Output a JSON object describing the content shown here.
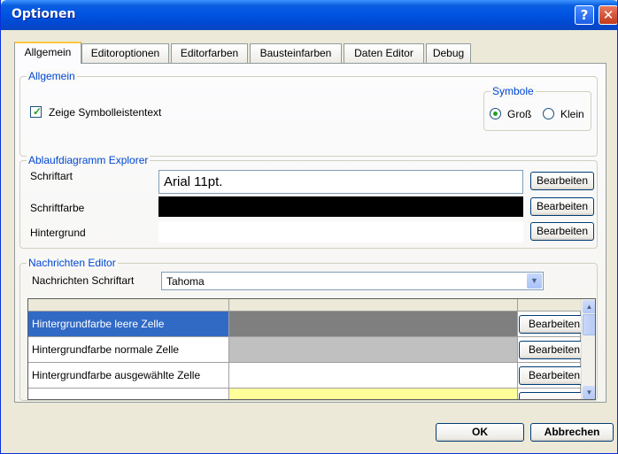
{
  "window": {
    "title": "Optionen",
    "help_label": "?",
    "close_label": "✕"
  },
  "tabs": [
    {
      "label": "Allgemein",
      "active": true
    },
    {
      "label": "Editoroptionen",
      "active": false
    },
    {
      "label": "Editorfarben",
      "active": false
    },
    {
      "label": "Bausteinfarben",
      "active": false
    },
    {
      "label": "Daten Editor",
      "active": false
    },
    {
      "label": "Debug",
      "active": false
    }
  ],
  "allgemein": {
    "group_label": "Allgemein",
    "show_toolbar_text": {
      "label": "Zeige Symbolleistentext",
      "checked": true
    },
    "symbole": {
      "group_label": "Symbole",
      "options": [
        {
          "label": "Groß",
          "selected": true
        },
        {
          "label": "Klein",
          "selected": false
        }
      ]
    }
  },
  "explorer": {
    "group_label": "Ablaufdiagramm Explorer",
    "rows": [
      {
        "label": "Schriftart",
        "value": "Arial 11pt.",
        "swatch": "#ffffff",
        "button": "Bearbeiten"
      },
      {
        "label": "Schriftfarbe",
        "value": "",
        "swatch": "#000000",
        "button": "Bearbeiten"
      },
      {
        "label": "Hintergrund",
        "value": "",
        "swatch": "#ffffff",
        "button": "Bearbeiten"
      }
    ]
  },
  "nachrichten": {
    "group_label": "Nachrichten Editor",
    "font_label": "Nachrichten Schriftart",
    "font_value": "Tahoma",
    "grid": {
      "rows": [
        {
          "label": "Hintergrundfarbe leere Zelle",
          "swatch": "#7f7f7f",
          "button": "Bearbeiten",
          "selected": true
        },
        {
          "label": "Hintergrundfarbe normale Zelle",
          "swatch": "#c0c0c0",
          "button": "Bearbeiten",
          "selected": false
        },
        {
          "label": "Hintergrundfarbe ausgewählte Zelle",
          "swatch": "#ffffff",
          "button": "Bearbeiten",
          "selected": false
        },
        {
          "label": "",
          "swatch": "#ffff99",
          "button": "",
          "selected": false
        }
      ]
    }
  },
  "footer": {
    "ok_label": "OK",
    "cancel_label": "Abbrechen"
  },
  "colors": {
    "accent": "#0054e3",
    "selection": "#316ac5",
    "group_label": "#0046d5"
  }
}
